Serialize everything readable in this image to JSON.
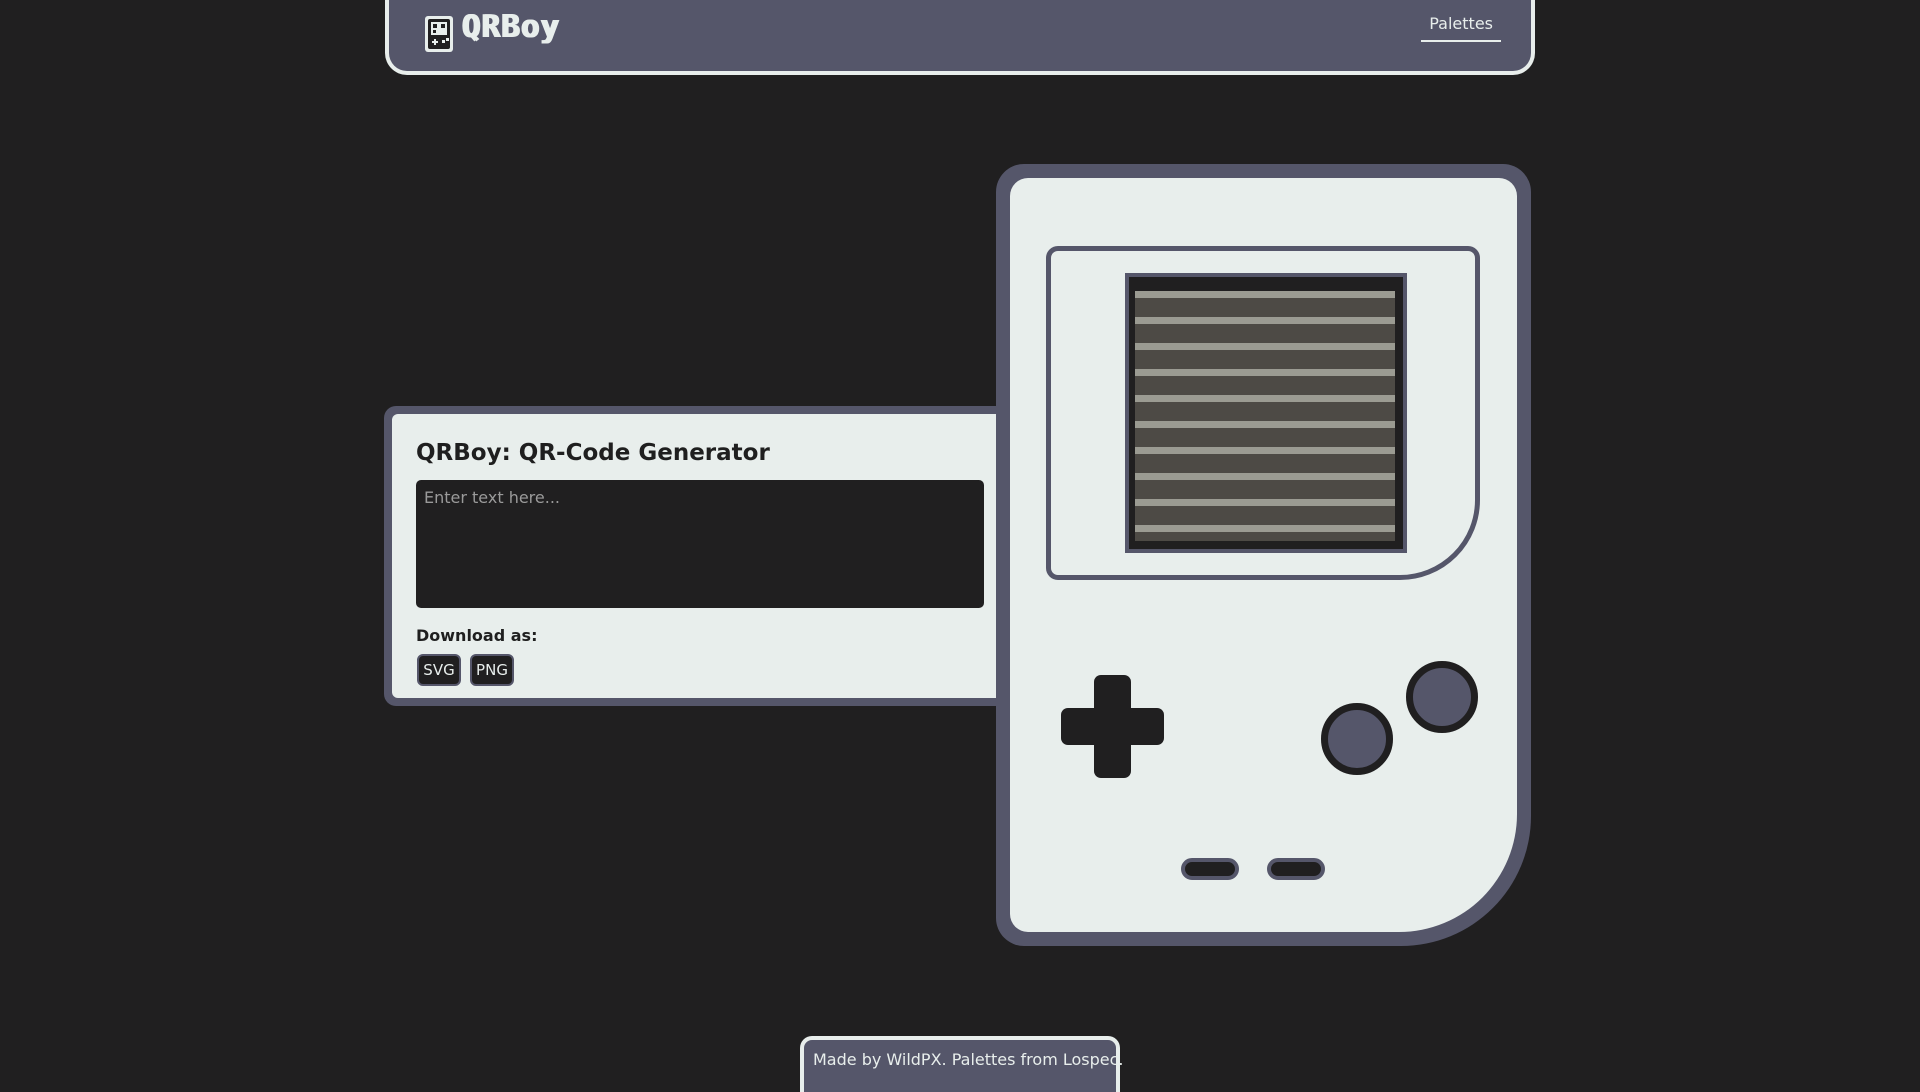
{
  "header": {
    "logo_text": "QRBoy",
    "logo_icon": "gameboy-qr-icon",
    "nav": {
      "palettes_label": "Palettes"
    }
  },
  "generator": {
    "title": "QRBoy: QR-Code Generator",
    "input_placeholder": "Enter text here...",
    "input_value": "",
    "download_label": "Download as:",
    "svg_label": "SVG",
    "png_label": "PNG"
  },
  "footer": {
    "made_by_prefix": "Made by ",
    "author_link": "WildPX",
    "middle": ". Palettes from ",
    "source_link": "Lospec",
    "suffix": "."
  },
  "colors": {
    "background": "#201f20",
    "frame": "#55566a",
    "light": "#e8eeec",
    "dark": "#201f20",
    "screen_stripe": "#9b9b92",
    "screen_gap": "#4d4a45"
  }
}
